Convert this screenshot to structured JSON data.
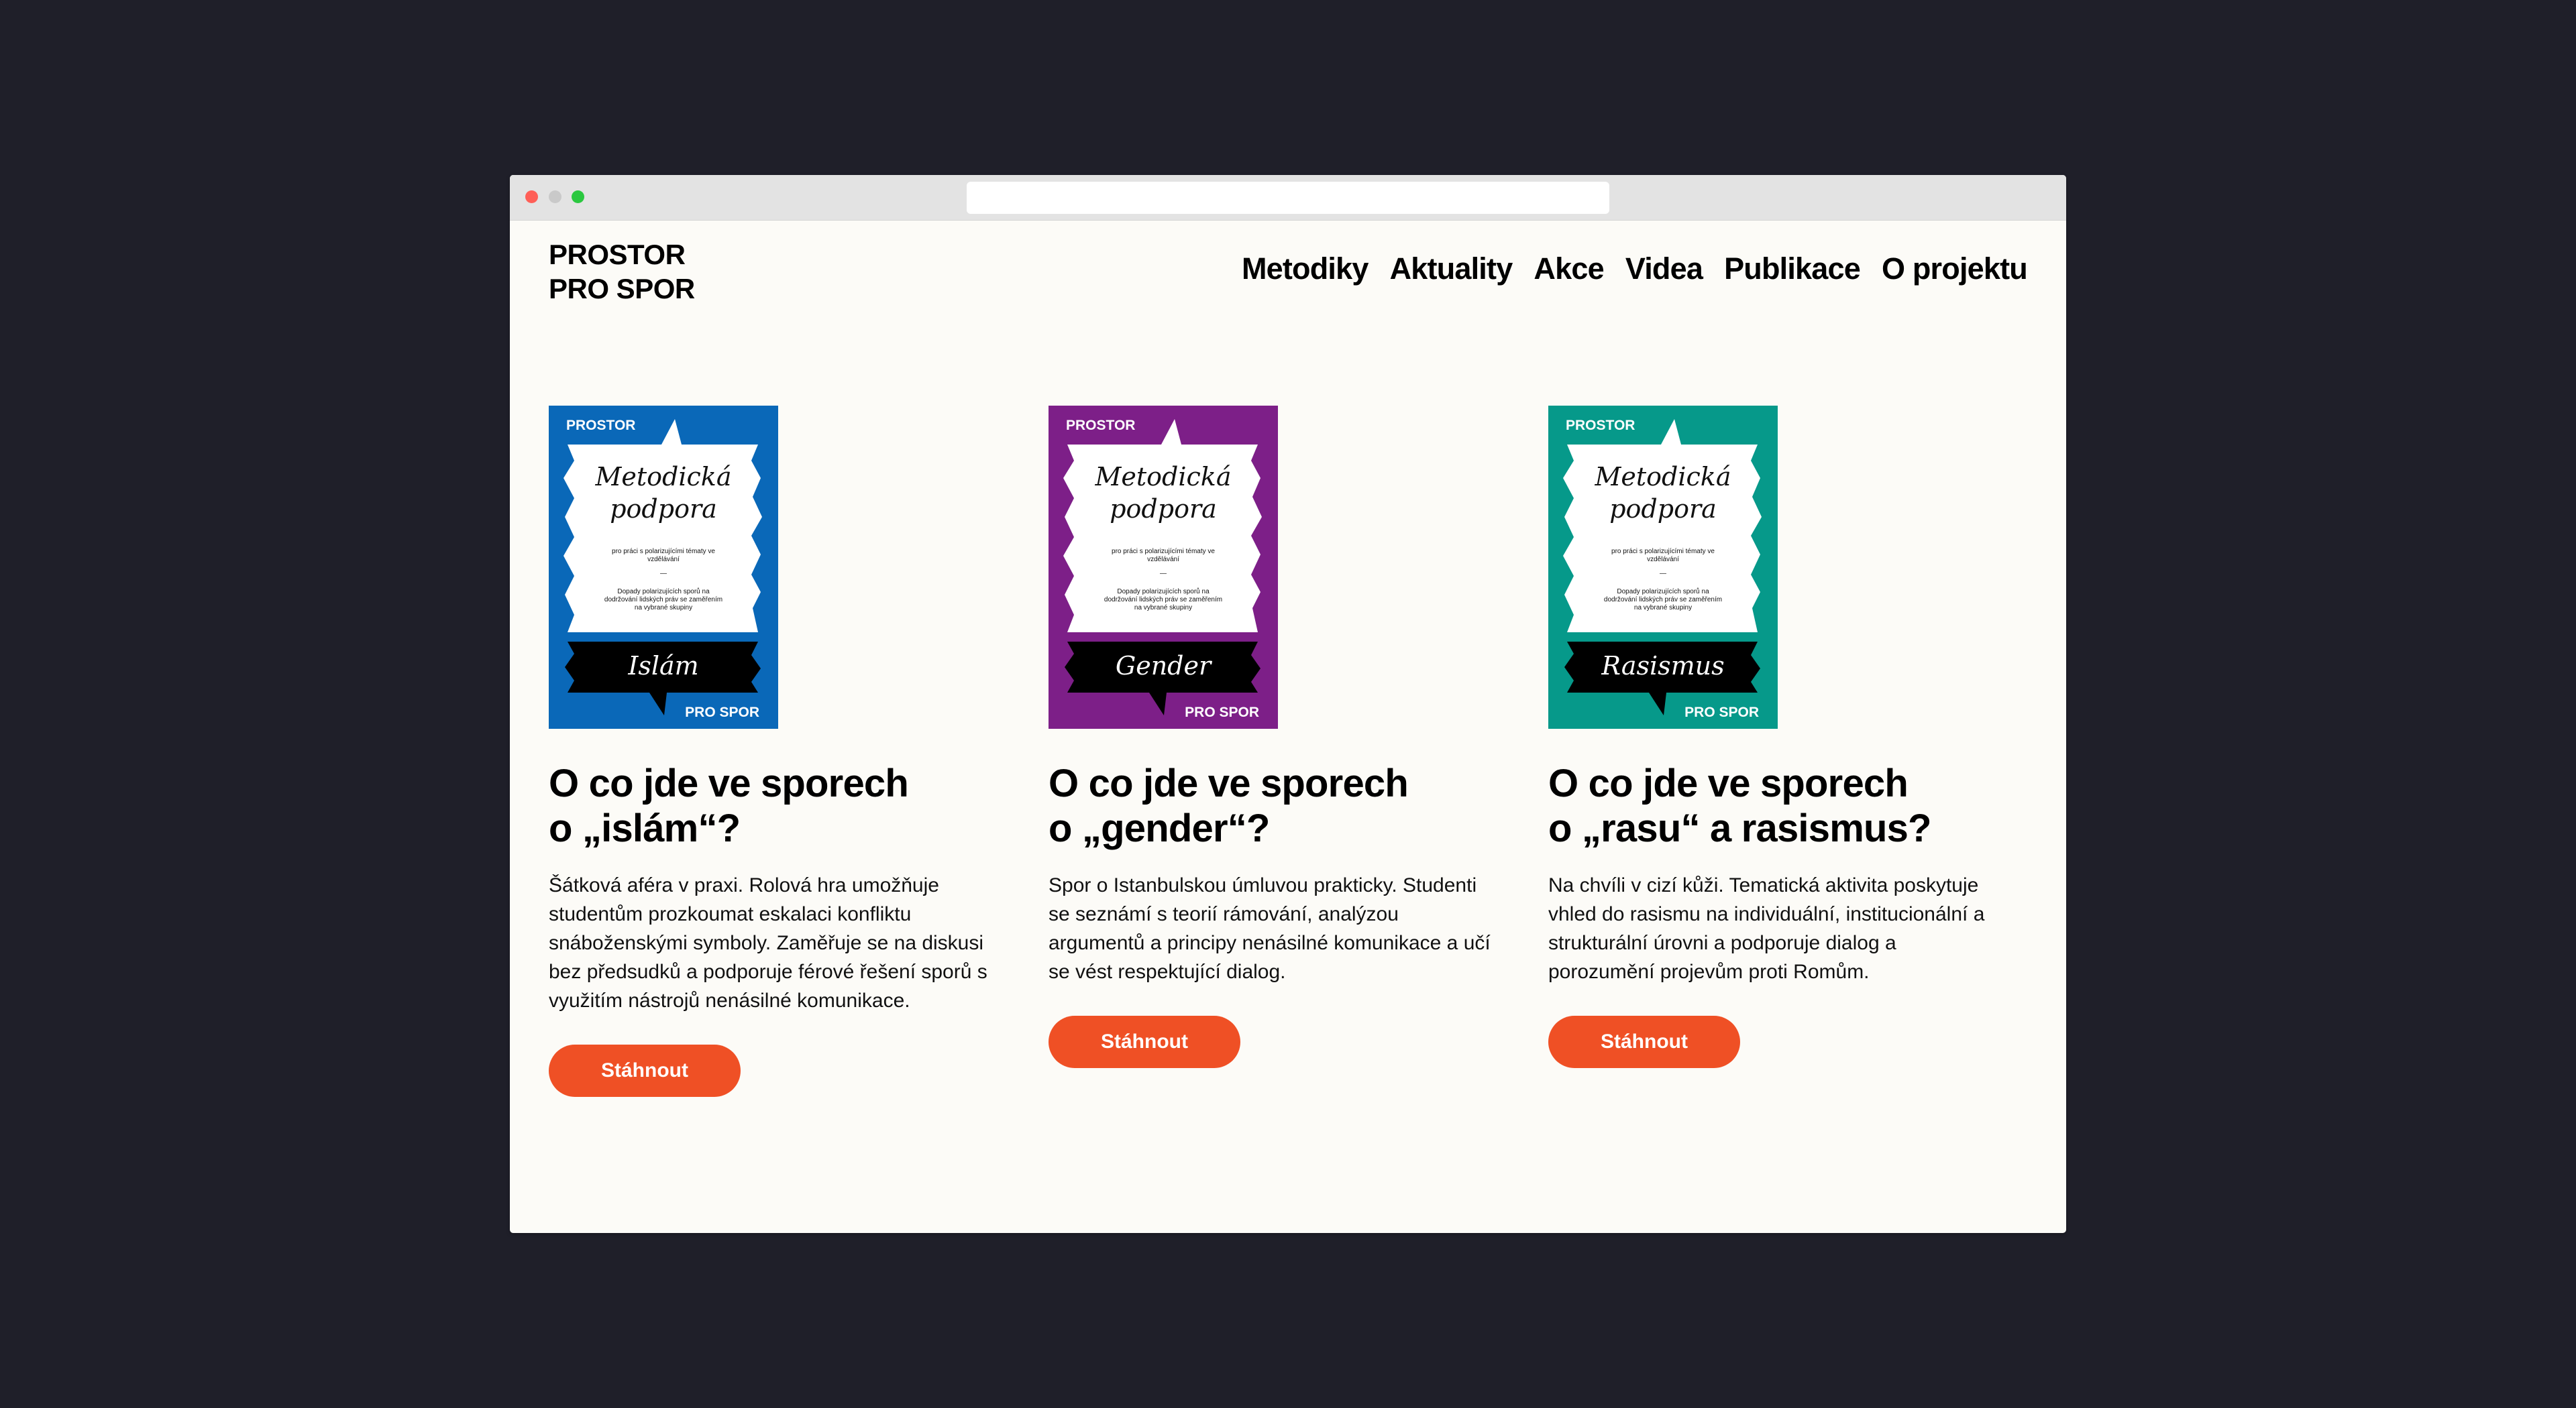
{
  "brand": {
    "line1": "PROSTOR",
    "line2": "PRO SPOR"
  },
  "nav": [
    "Metodiky",
    "Aktuality",
    "Akce",
    "Videa",
    "Publikace",
    "O projektu"
  ],
  "cover_common": {
    "top_label": "PROSTOR",
    "bottom_label": "PRO SPOR",
    "script_title": "Metodická podpora",
    "subtitle": "pro práci s polarizujícími tématy ve vzdělávání",
    "dash": "—",
    "description": "Dopady polarizujících sporů na dodržování lidských práv se zaměřením na vybrané skupiny"
  },
  "cards": [
    {
      "cover_color": "#0a68b8",
      "cover_tag": "Islám",
      "title_line1": "O co jde ve sporech",
      "title_line2": "o „islám“?",
      "description": "Šátková aféra v praxi. Rolová hra umožňuje studentům prozkoumat eskalaci konfliktu snáboženskými symboly. Zaměřuje se na diskusi bez předsudků a podporuje férové řešení sporů s využitím nástrojů nenásilné komunikace.",
      "button": "Stáhnout"
    },
    {
      "cover_color": "#7d1f88",
      "cover_tag": "Gender",
      "title_line1": "O co jde ve sporech",
      "title_line2": "o „gender“?",
      "description": "Spor o Istanbulskou úmluvou prakticky. Studenti se seznámí s teorií rámování, analýzou argumentů a principy nenásilné komunikace a učí se vést respektující dialog.",
      "button": "Stáhnout"
    },
    {
      "cover_color": "#06998a",
      "cover_tag": "Rasismus",
      "title_line1": "O co jde ve sporech",
      "title_line2": "o „rasu“ a rasismus?",
      "description": "Na chvíli v cizí kůži. Tematická aktivita poskytuje vhled do rasismu na individuální, institucionální a strukturální úrovni a podporuje dialog a porozumění projevům proti Romům.",
      "button": "Stáhnout"
    }
  ]
}
